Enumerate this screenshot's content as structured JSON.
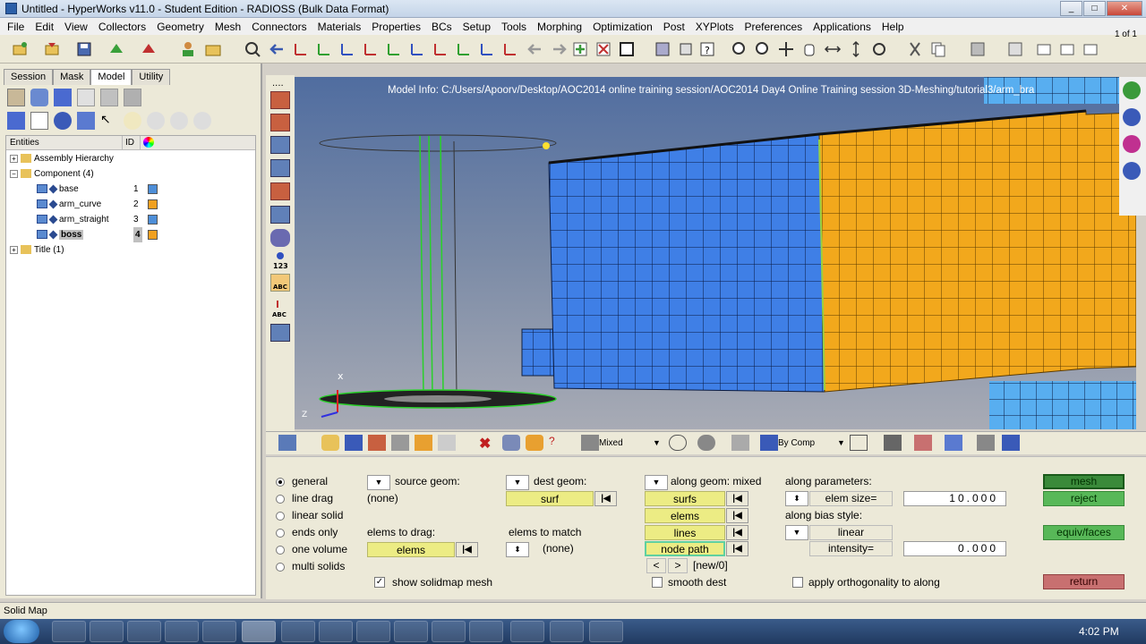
{
  "window": {
    "title": "Untitled - HyperWorks v11.0 - Student Edition - RADIOSS (Bulk Data Format)",
    "minimize": "_",
    "maximize": "□",
    "close": "✕"
  },
  "menu": [
    "File",
    "Edit",
    "View",
    "Collectors",
    "Geometry",
    "Mesh",
    "Connectors",
    "Materials",
    "Properties",
    "BCs",
    "Setup",
    "Tools",
    "Morphing",
    "Optimization",
    "Post",
    "XYPlots",
    "Preferences",
    "Applications",
    "Help"
  ],
  "page_count": "1 of 1",
  "left_tabs": [
    "Session",
    "Mask",
    "Model",
    "Utility"
  ],
  "tree": {
    "col_entities": "Entities",
    "col_id": "ID",
    "rows": [
      {
        "label": "Assembly Hierarchy"
      },
      {
        "label": "Component (4)"
      },
      {
        "label": "base",
        "id": "1",
        "color": "#4d8ed8"
      },
      {
        "label": "arm_curve",
        "id": "2",
        "color": "#f0a020"
      },
      {
        "label": "arm_straight",
        "id": "3",
        "color": "#4d8ed8"
      },
      {
        "label": "boss",
        "id": "4",
        "color": "#f0a020"
      },
      {
        "label": "Title (1)"
      }
    ]
  },
  "graphics": {
    "model_info": "Model Info: C:/Users/Apoorv/Desktop/AOC2014 online training session/AOC2014 Day4 Online Training session 3D-Meshing/tutorial3/arm_bra",
    "colors": {
      "blue_mesh": "#3f7fe6",
      "orange_mesh": "#f2a81c",
      "background_top": "#506da0",
      "background_bottom": "#a8abb5"
    }
  },
  "bottom_toolbar": {
    "display_mode": "Mixed",
    "color_mode": "By Comp"
  },
  "panel": {
    "options": [
      "general",
      "line drag",
      "linear solid",
      "ends only",
      "one volume",
      "multi solids"
    ],
    "selected_option": "general",
    "source_geom_label": "source geom:",
    "source_geom_value": "(none)",
    "dest_geom_label": "dest geom:",
    "dest_geom_btn": "surf",
    "elems_to_drag_label": "elems to drag:",
    "elems_to_drag_btn": "elems",
    "elems_to_match_label": "elems to match",
    "elems_to_match_value": "(none)",
    "show_solidmap_mesh": "show solidmap mesh",
    "along_geom_label": "along geom: mixed",
    "along_btns": [
      "surfs",
      "elems",
      "lines",
      "node path"
    ],
    "node_path_nav_prev": "<",
    "node_path_nav_next": ">",
    "node_path_new": "[new/0]",
    "smooth_dest": "smooth dest",
    "along_params_label": "along parameters:",
    "elem_size_label": "elem size=",
    "elem_size_value": "10.000",
    "along_bias_label": "along bias style:",
    "bias_style": "linear",
    "intensity_label": "intensity=",
    "intensity_value": "0.000",
    "apply_orthogonality": "apply orthogonality to along",
    "mesh_btn": "mesh",
    "reject_btn": "reject",
    "equiv_btn": "equiv/faces",
    "return_btn": "return"
  },
  "status": "Solid Map",
  "taskbar": {
    "clock": "4:02 PM"
  }
}
